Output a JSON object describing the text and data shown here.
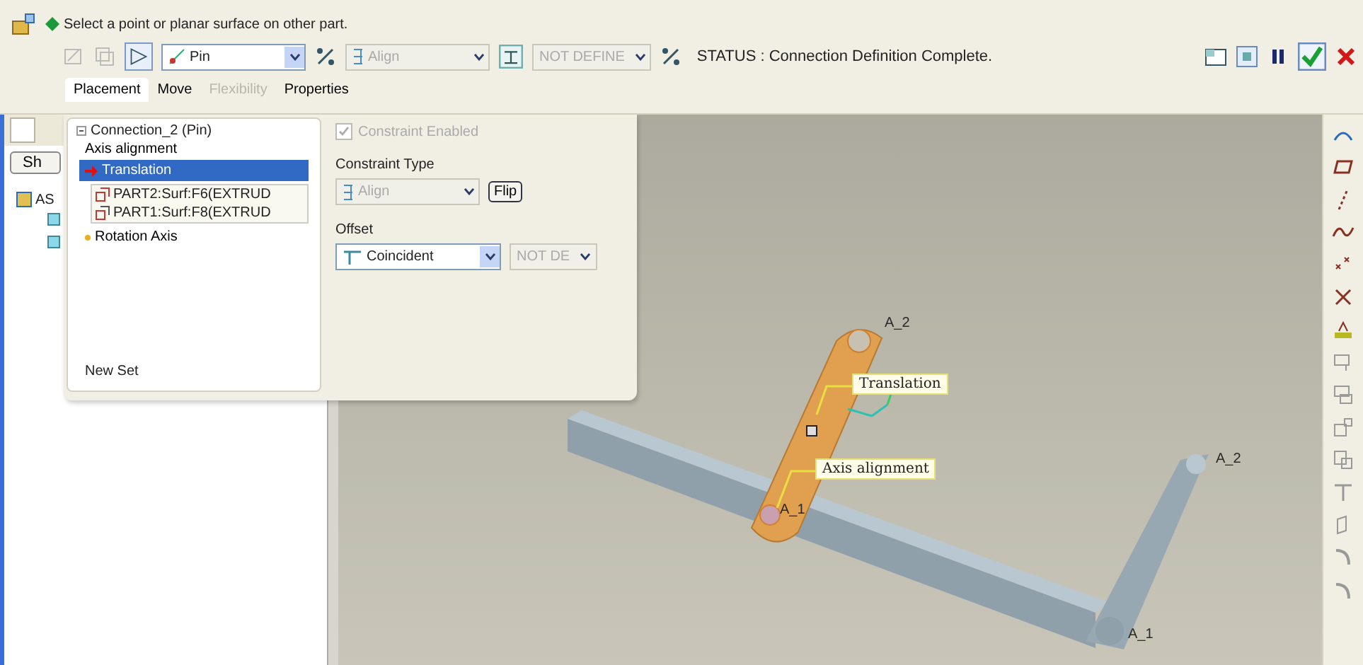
{
  "prompt": "Select a point or planar surface on other part.",
  "toolbar": {
    "connection_type": "Pin",
    "constraint_type": "Align",
    "offset_value": "NOT DEFINE",
    "status": "STATUS : Connection Definition Complete."
  },
  "tabs": [
    {
      "label": "Placement",
      "selected": true,
      "disabled": false
    },
    {
      "label": "Move",
      "selected": false,
      "disabled": false
    },
    {
      "label": "Flexibility",
      "selected": false,
      "disabled": true
    },
    {
      "label": "Properties",
      "selected": false,
      "disabled": false
    }
  ],
  "model_tree": {
    "button": "Sh",
    "root": "AS"
  },
  "placement": {
    "set_title": "Connection_2 (Pin)",
    "items": [
      {
        "label": "Axis alignment",
        "kind": "constraint",
        "selected": false
      },
      {
        "label": "Translation",
        "kind": "constraint",
        "selected": true,
        "references": [
          "PART2:Surf:F6(EXTRUD",
          "PART1:Surf:F8(EXTRUD"
        ]
      },
      {
        "label": "Rotation Axis",
        "kind": "motion_axis",
        "selected": false
      }
    ],
    "new_set": "New Set",
    "constraint_enabled": {
      "label": "Constraint Enabled",
      "checked": true,
      "disabled": true
    },
    "constraint_type_label": "Constraint Type",
    "constraint_type": "Align",
    "flip": "Flip",
    "offset_label": "Offset",
    "offset": "Coincident",
    "offset_value": "NOT DE"
  },
  "viewport": {
    "callouts": [
      "Translation",
      "Axis alignment"
    ],
    "axis_labels": [
      "A_2",
      "A_1",
      "A_2",
      "A_1"
    ]
  }
}
